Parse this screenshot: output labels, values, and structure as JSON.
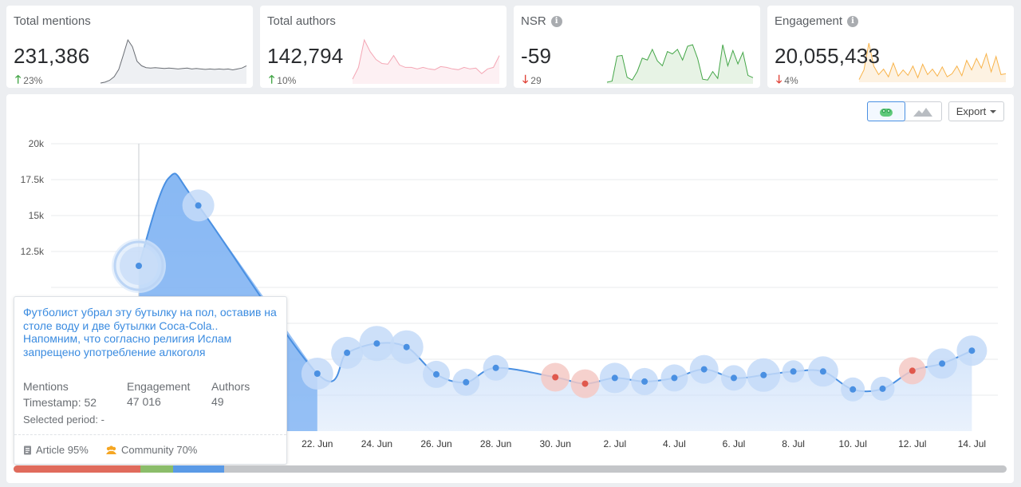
{
  "kpis": [
    {
      "title": "Total mentions",
      "value": "231,386",
      "delta": "23%",
      "direction": "up",
      "info": false,
      "color": "#6b6f75",
      "fill": "#eef0f3",
      "series": [
        0,
        2,
        6,
        14,
        30,
        62,
        95,
        80,
        48,
        38,
        34,
        33,
        34,
        33,
        32,
        33,
        32,
        31,
        32,
        33,
        31,
        32,
        31,
        30,
        31,
        30,
        31,
        30,
        31,
        29,
        31,
        33,
        38
      ]
    },
    {
      "title": "Total authors",
      "value": "142,794",
      "delta": "10%",
      "direction": "up",
      "info": false,
      "color": "#f4a7b5",
      "fill": "#fdf0f3",
      "series": [
        5,
        20,
        55,
        40,
        30,
        25,
        24,
        35,
        23,
        20,
        20,
        18,
        20,
        18,
        17,
        21,
        20,
        18,
        17,
        20,
        18,
        19,
        12,
        18,
        20,
        35
      ]
    },
    {
      "title": "NSR",
      "value": "-59",
      "delta": "29",
      "direction": "down",
      "info": true,
      "color": "#44a648",
      "fill": "#e7f3e5",
      "series": [
        2,
        5,
        70,
        72,
        15,
        8,
        30,
        65,
        60,
        88,
        58,
        45,
        82,
        76,
        88,
        60,
        96,
        100,
        64,
        10,
        8,
        30,
        12,
        100,
        45,
        85,
        50,
        80,
        20,
        14
      ]
    },
    {
      "title": "Engagement",
      "value": "20,055,433",
      "delta": "4%",
      "direction": "down",
      "info": true,
      "color": "#f8b34a",
      "fill": "#fdf2e2",
      "series": [
        5,
        30,
        100,
        40,
        18,
        32,
        12,
        48,
        14,
        30,
        16,
        40,
        10,
        45,
        18,
        32,
        14,
        38,
        12,
        20,
        40,
        15,
        55,
        30,
        60,
        35,
        72,
        25,
        65,
        18,
        20
      ]
    }
  ],
  "toolbar": {
    "export_label": "Export"
  },
  "chart_data": {
    "type": "area",
    "y_ticks": [
      "20k",
      "17.5k",
      "15k",
      "12.5k"
    ],
    "ylim": [
      0,
      20000
    ],
    "y_ticks_values": [
      20000,
      17500,
      15000,
      12500
    ],
    "x_labels": [
      "22. Jun",
      "24. Jun",
      "26. Jun",
      "28. Jun",
      "30. Jun",
      "2. Jul",
      "4. Jul",
      "6. Jul",
      "8. Jul",
      "10. Jul",
      "12. Jul",
      "14. Jul"
    ],
    "series": [
      {
        "values": [
          {
            "d": 0,
            "y": 11500,
            "r": 0
          },
          {
            "d": 2,
            "y": 15700,
            "r": 20
          },
          {
            "d": 6,
            "y": 4000,
            "r": 20
          },
          {
            "d": 7,
            "y": 5450,
            "r": 20
          },
          {
            "d": 8,
            "y": 6100,
            "r": 22
          },
          {
            "d": 9,
            "y": 5850,
            "r": 21
          },
          {
            "d": 10,
            "y": 3950,
            "r": 17
          },
          {
            "d": 11,
            "y": 3400,
            "r": 17
          },
          {
            "d": 12,
            "y": 4400,
            "r": 16
          },
          {
            "d": 14,
            "y": 3750,
            "r": 18,
            "neg": true
          },
          {
            "d": 15,
            "y": 3300,
            "r": 18,
            "neg": true
          },
          {
            "d": 16,
            "y": 3700,
            "r": 19
          },
          {
            "d": 17,
            "y": 3450,
            "r": 17
          },
          {
            "d": 18,
            "y": 3700,
            "r": 17
          },
          {
            "d": 19,
            "y": 4300,
            "r": 18
          },
          {
            "d": 20,
            "y": 3700,
            "r": 16
          },
          {
            "d": 21,
            "y": 3900,
            "r": 21
          },
          {
            "d": 22,
            "y": 4150,
            "r": 14
          },
          {
            "d": 23,
            "y": 4150,
            "r": 19
          },
          {
            "d": 24,
            "y": 2900,
            "r": 15
          },
          {
            "d": 25,
            "y": 2950,
            "r": 15
          },
          {
            "d": 26,
            "y": 4200,
            "r": 17,
            "neg": true
          },
          {
            "d": 27,
            "y": 4700,
            "r": 19
          },
          {
            "d": 28,
            "y": 5600,
            "r": 19
          }
        ]
      },
      {
        "name": "peak_area",
        "values": [
          {
            "d": 1,
            "y": 17600
          }
        ]
      }
    ],
    "selected_date_index": 0
  },
  "tooltip": {
    "text": "Футболист убрал эту бутылку на пол, оставив на столе воду и две бутылки Coca-Cola.. Напомним, что согласно религия Ислам запрещено употребление алкоголя",
    "mentions_label": "Mentions",
    "timestamp_label": "Timestamp: 52",
    "engagement_label": "Engagement",
    "engagement_value": "47 016",
    "authors_label": "Authors",
    "authors_value": "49",
    "selected_period": "Selected period: -",
    "article": "Article 95%",
    "community": "Community 70%"
  },
  "period_bar": [
    {
      "color": "#e06b5c",
      "fraction": 0.128
    },
    {
      "color": "#8bbd6a",
      "fraction": 0.033
    },
    {
      "color": "#5a9ae6",
      "fraction": 0.051
    }
  ]
}
